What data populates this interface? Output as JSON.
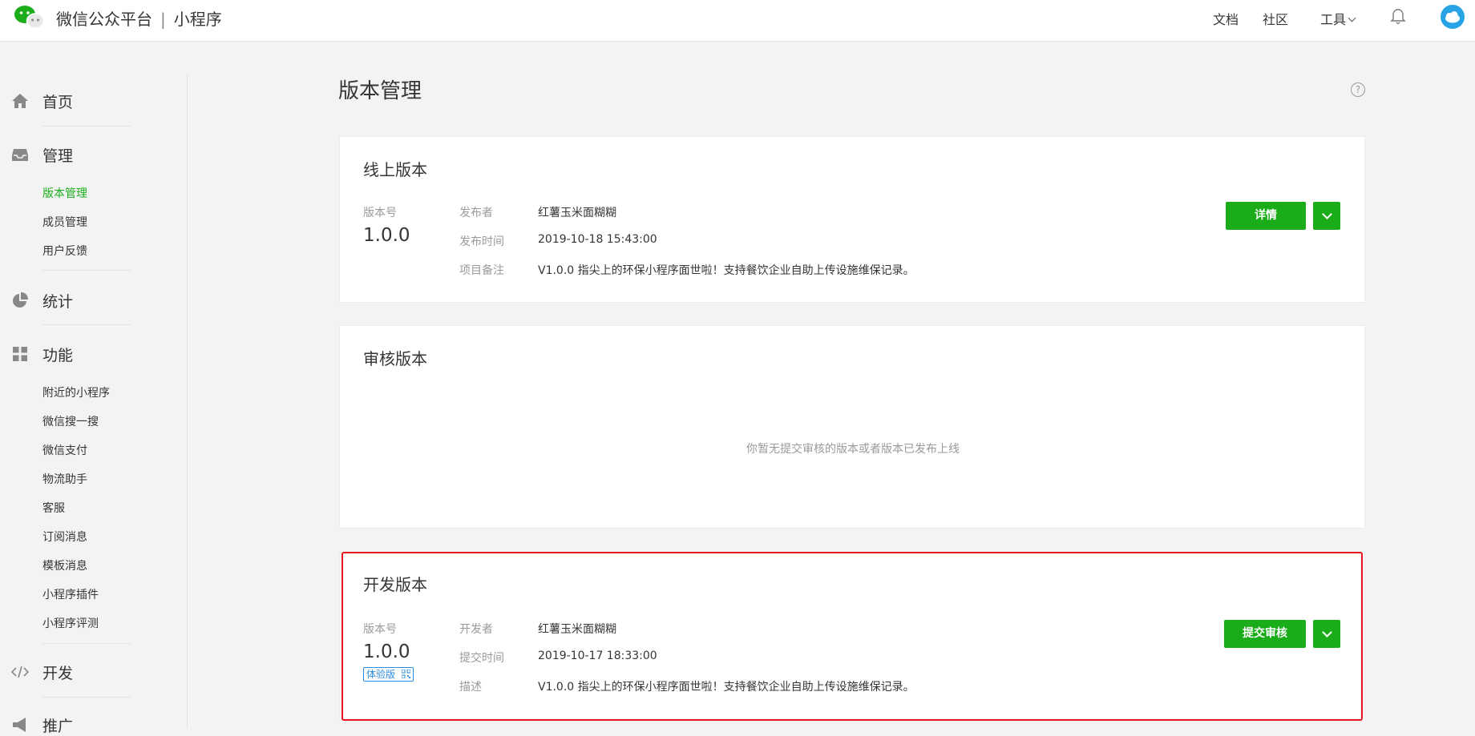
{
  "header": {
    "brand": "微信公众平台",
    "separator": "|",
    "product": "小程序",
    "nav": {
      "docs": "文档",
      "community": "社区",
      "tools": "工具"
    },
    "icons": {
      "logo": "wechat-logo-icon",
      "bell": "bell-icon",
      "avatar": "avatar-icon"
    },
    "colors": {
      "brand_green": "#1aad19",
      "avatar_blue": "#27a3e6"
    }
  },
  "sidebar": {
    "sections": [
      {
        "label": "首页",
        "icon": "home-icon"
      },
      {
        "label": "管理",
        "icon": "inbox-icon",
        "items": [
          "版本管理",
          "成员管理",
          "用户反馈"
        ],
        "active": "版本管理"
      },
      {
        "label": "统计",
        "icon": "pie-chart-icon"
      },
      {
        "label": "功能",
        "icon": "grid-icon",
        "items": [
          "附近的小程序",
          "微信搜一搜",
          "微信支付",
          "物流助手",
          "客服",
          "订阅消息",
          "模板消息",
          "小程序插件",
          "小程序评测"
        ]
      },
      {
        "label": "开发",
        "icon": "code-icon"
      },
      {
        "label": "推广",
        "icon": "megaphone-icon"
      }
    ]
  },
  "main": {
    "title": "版本管理",
    "help": "?",
    "online": {
      "title": "线上版本",
      "version_label": "版本号",
      "version": "1.0.0",
      "publisher_label": "发布者",
      "publisher": "红薯玉米面糊糊",
      "time_label": "发布时间",
      "time": "2019-10-18 15:43:00",
      "note_label": "项目备注",
      "note": "V1.0.0 指尖上的环保小程序面世啦！支持餐饮企业自助上传设施维保记录。",
      "button": "详情"
    },
    "review": {
      "title": "审核版本",
      "empty": "你暂无提交审核的版本或者版本已发布上线"
    },
    "dev": {
      "title": "开发版本",
      "version_label": "版本号",
      "version": "1.0.0",
      "badge": "体验版",
      "developer_label": "开发者",
      "developer": "红薯玉米面糊糊",
      "time_label": "提交时间",
      "time": "2019-10-17 18:33:00",
      "desc_label": "描述",
      "desc": "V1.0.0 指尖上的环保小程序面世啦！支持餐饮企业自助上传设施维保记录。",
      "button": "提交审核",
      "highlight_color": "#e8171d"
    }
  }
}
